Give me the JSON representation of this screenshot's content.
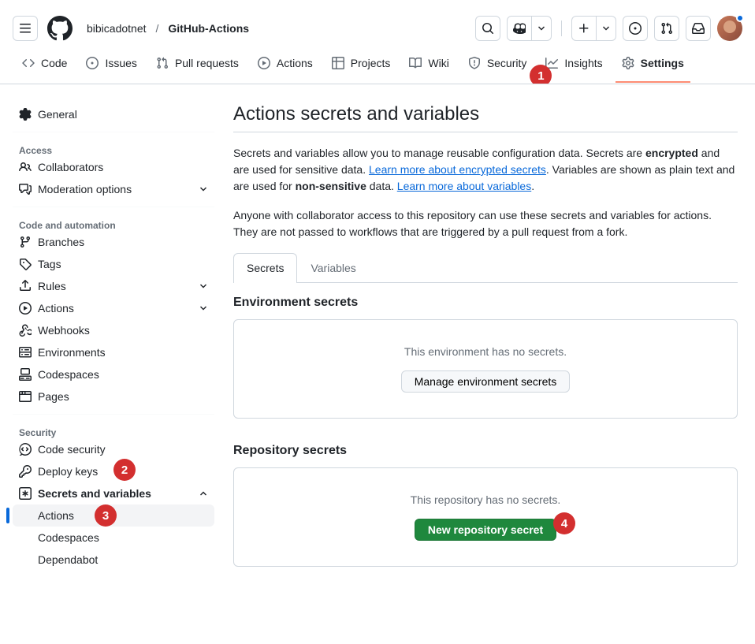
{
  "breadcrumb": {
    "owner": "bibicadotnet",
    "repo": "GitHub-Actions"
  },
  "repo_nav": [
    {
      "id": "code",
      "label": "Code"
    },
    {
      "id": "issues",
      "label": "Issues"
    },
    {
      "id": "pull",
      "label": "Pull requests"
    },
    {
      "id": "actions",
      "label": "Actions"
    },
    {
      "id": "projects",
      "label": "Projects"
    },
    {
      "id": "wiki",
      "label": "Wiki"
    },
    {
      "id": "security",
      "label": "Security"
    },
    {
      "id": "insights",
      "label": "Insights"
    },
    {
      "id": "settings",
      "label": "Settings"
    }
  ],
  "sidebar": {
    "general": "General",
    "section_access": "Access",
    "collaborators": "Collaborators",
    "moderation": "Moderation options",
    "section_code": "Code and automation",
    "branches": "Branches",
    "tags": "Tags",
    "rules": "Rules",
    "actions": "Actions",
    "webhooks": "Webhooks",
    "environments": "Environments",
    "codespaces": "Codespaces",
    "pages": "Pages",
    "section_security": "Security",
    "code_security": "Code security",
    "deploy_keys": "Deploy keys",
    "secrets_vars": "Secrets and variables",
    "sub_actions": "Actions",
    "sub_codespaces": "Codespaces",
    "sub_dependabot": "Dependabot"
  },
  "page": {
    "title": "Actions secrets and variables",
    "desc1a": "Secrets and variables allow you to manage reusable configuration data. Secrets are ",
    "desc1b": "encrypted",
    "desc1c": " and are used for sensitive data. ",
    "link1": "Learn more about encrypted secrets",
    "desc1d": ". Variables are shown as plain text and are used for ",
    "desc1e": "non-sensitive",
    "desc1f": " data. ",
    "link2": "Learn more about variables",
    "desc2": "Anyone with collaborator access to this repository can use these secrets and variables for actions. They are not passed to workflows that are triggered by a pull request from a fork.",
    "tab_secrets": "Secrets",
    "tab_variables": "Variables",
    "env_title": "Environment secrets",
    "env_empty": "This environment has no secrets.",
    "env_btn": "Manage environment secrets",
    "repo_title": "Repository secrets",
    "repo_empty": "This repository has no secrets.",
    "repo_btn": "New repository secret"
  },
  "annotations": {
    "a1": "1",
    "a2": "2",
    "a3": "3",
    "a4": "4"
  }
}
